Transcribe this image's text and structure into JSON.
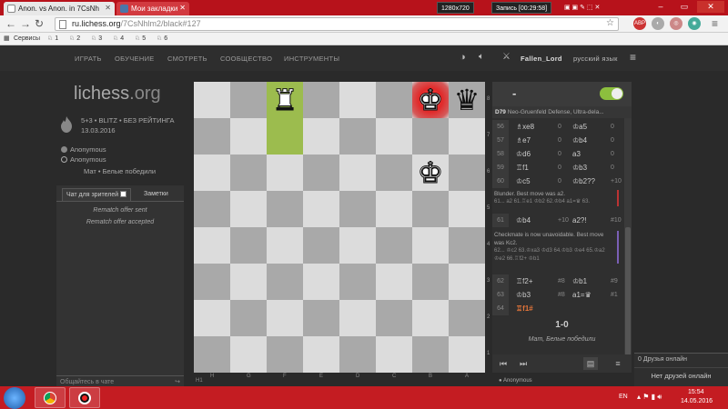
{
  "browser": {
    "tabs": [
      {
        "title": "Anon. vs Anon. in 7CsNh",
        "active": true
      },
      {
        "title": "Мои закладки",
        "active": false
      }
    ],
    "recorder": {
      "resolution": "1280x720",
      "label": "Запись [00:29:58]"
    },
    "url": {
      "host": "ru.lichess.org",
      "path": "/7CsNhlm2/black#127"
    },
    "bookmarks": [
      {
        "label": "Сервисы"
      },
      {
        "label": "1"
      },
      {
        "label": "2"
      },
      {
        "label": "3"
      },
      {
        "label": "4"
      },
      {
        "label": "5"
      },
      {
        "label": "6"
      }
    ]
  },
  "nav": {
    "items": [
      "ИГРАТЬ",
      "ОБУЧЕНИЕ",
      "СМОТРЕТЬ",
      "СООБЩЕСТВО",
      "ИНСТРУМЕНТЫ"
    ],
    "username": "Fallen_Lord",
    "language": "русский язык"
  },
  "logo": {
    "main": "lichess",
    "suffix": ".org"
  },
  "game": {
    "type": "5+3 • BLITZ • БЕЗ РЕЙТИНГА",
    "date": "13.03.2016",
    "players": [
      "Anonymous",
      "Anonymous"
    ],
    "status": "Мат • Белые победили"
  },
  "chat": {
    "tab_chat": "Чат для зрителей",
    "tab_notes": "Заметки",
    "messages": [
      "Rematch offer sent",
      "Rematch offer accepted"
    ],
    "input_placeholder": "Общайтесь в чате"
  },
  "board": {
    "pieces": [
      {
        "square": "f8",
        "symbol": "♜",
        "color": "white"
      },
      {
        "square": "b8",
        "symbol": "♚",
        "color": "white"
      },
      {
        "square": "a8",
        "symbol": "♛",
        "color": "black"
      },
      {
        "square": "b6",
        "symbol": "♚",
        "color": "white"
      }
    ],
    "highlight": [
      "f8",
      "f7"
    ],
    "check_square": "b8",
    "ranks": [
      "1",
      "2",
      "3",
      "4",
      "5",
      "6",
      "7",
      "8"
    ],
    "files": [
      "H",
      "G",
      "F",
      "E",
      "D",
      "C",
      "B",
      "A"
    ]
  },
  "panel": {
    "clock": "-",
    "opening": {
      "code": "D79",
      "name": "Neo-Gruenfeld Defense, Ultra-dela..."
    },
    "moves_top": [
      {
        "n": "56",
        "w": "♗xe8",
        "ws": "0",
        "b": "♔a5",
        "bs": "0"
      },
      {
        "n": "57",
        "w": "♗e7",
        "ws": "0",
        "b": "♔b4",
        "bs": "0"
      },
      {
        "n": "58",
        "w": "♔d6",
        "ws": "0",
        "b": "a3",
        "bs": "0"
      },
      {
        "n": "59",
        "w": "♖f1",
        "ws": "0",
        "b": "♔b3",
        "bs": "0"
      },
      {
        "n": "60",
        "w": "♔c5",
        "ws": "0",
        "b": "♔b2??",
        "bs": "+10"
      }
    ],
    "comment1": {
      "text": "Blunder. Best move was a2.",
      "variation": "61... a2 61.♖e1 ♔b2 62.♔b4 a1=♛ 63."
    },
    "move61": {
      "n": "61",
      "w": "♔b4",
      "ws": "+10",
      "b": "a2?!",
      "bs": "#10"
    },
    "comment2": {
      "text": "Checkmate is now unavoidable. Best move was Kc2.",
      "variation": "62... ♔c2 63.♔xa3 ♔d3 64.♔b3 ♔e4 65.♔a2 ♔e2 66.♖f2+ ♔b1"
    },
    "moves_bottom": [
      {
        "n": "62",
        "w": "♖f2+",
        "ws": "#8",
        "b": "♔b1",
        "bs": "#9"
      },
      {
        "n": "63",
        "w": "♔b3",
        "ws": "#8",
        "b": "a1=♛",
        "bs": "#1"
      },
      {
        "n": "64",
        "w": "♖f1#",
        "ws": "",
        "b": "",
        "bs": ""
      }
    ],
    "result": "1-0",
    "result_text": "Мат, Белые победили"
  },
  "friends": {
    "header": "0 Друзья онлайн",
    "text": "Нет друзей онлайн"
  },
  "bottom": {
    "player": "Anonymous",
    "coord": "H1"
  },
  "taskbar": {
    "lang": "EN",
    "time": "15:54",
    "date": "14.05.2016"
  },
  "colors": {
    "accent_red": "#b7121b",
    "highlight_green": "#9cbc4e",
    "toggle_green": "#8cbf3e",
    "orange_move": "#e4753a"
  }
}
